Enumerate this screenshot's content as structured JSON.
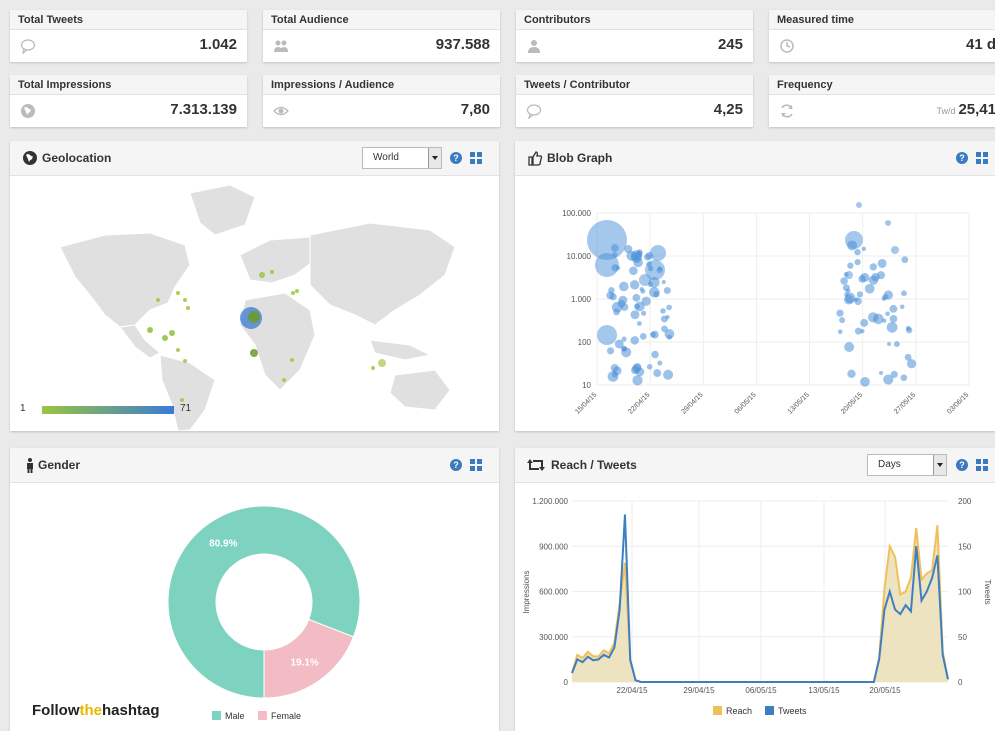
{
  "stats": [
    {
      "label": "Total Tweets",
      "value": "1.042",
      "icon": "speech-bubble-icon",
      "unit": ""
    },
    {
      "label": "Total Audience",
      "value": "937.588",
      "icon": "users-icon",
      "unit": ""
    },
    {
      "label": "Contributors",
      "value": "245",
      "icon": "user-icon",
      "unit": ""
    },
    {
      "label": "Measured time",
      "value": "41 d",
      "icon": "clock-icon",
      "unit": ""
    },
    {
      "label": "Total Impressions",
      "value": "7.313.139",
      "icon": "globe-icon",
      "unit": ""
    },
    {
      "label": "Impressions / Audience",
      "value": "7,80",
      "icon": "eye-icon",
      "unit": ""
    },
    {
      "label": "Tweets / Contributor",
      "value": "4,25",
      "icon": "speech-bubble-icon",
      "unit": ""
    },
    {
      "label": "Frequency",
      "value": "25,41",
      "icon": "refresh-icon",
      "unit": "Tw/d"
    }
  ],
  "geolocation": {
    "title": "Geolocation",
    "select": "World",
    "legend_min": "1",
    "legend_max": "71",
    "colors": {
      "low": "#9bc53d",
      "high": "#3a7bd5"
    }
  },
  "blob": {
    "title": "Blob Graph",
    "chart_data": {
      "type": "scatter",
      "y_scale": "log",
      "ylim": [
        10,
        100000
      ],
      "y_ticks": [
        "100.000",
        "10.000",
        "1.000",
        "100",
        "10"
      ],
      "x_ticks": [
        "15/04/15",
        "22/04/15",
        "29/04/15",
        "06/05/15",
        "13/05/15",
        "20/05/15",
        "27/05/15",
        "03/06/15"
      ],
      "note_colors": "#4a90d9"
    }
  },
  "gender": {
    "title": "Gender",
    "chart_data": {
      "type": "pie",
      "slices": [
        {
          "name": "Male",
          "value": 80.9,
          "label": "80.9%",
          "color": "#7dd3c0"
        },
        {
          "name": "Female",
          "value": 19.1,
          "label": "19.1%",
          "color": "#f3bcc4"
        }
      ]
    },
    "brand_prefix": "Follow",
    "brand_mid": "the",
    "brand_suffix": "hashtag"
  },
  "reach": {
    "title": "Reach / Tweets",
    "select": "Days",
    "chart_data": {
      "type": "area",
      "x_ticks": [
        "22/04/15",
        "29/04/15",
        "06/05/15",
        "13/05/15",
        "20/05/15"
      ],
      "y_left_ticks": [
        "1.200.000",
        "900.000",
        "600.000",
        "300.000",
        "0"
      ],
      "y_right_ticks": [
        "200",
        "150",
        "100",
        "50",
        "0"
      ],
      "ylabel": "Impressions",
      "y2label": "Tweets",
      "ylim": [
        0,
        1200000
      ],
      "y2lim": [
        0,
        200
      ],
      "series": [
        {
          "name": "Reach",
          "color": "#f0c05a",
          "values": [
            60000,
            180000,
            160000,
            200000,
            170000,
            170000,
            210000,
            190000,
            260000,
            520000,
            790000,
            150000,
            10000,
            0,
            0,
            0,
            0,
            0,
            0,
            0,
            0,
            0,
            0,
            0,
            0,
            0,
            0,
            0,
            0,
            0,
            0,
            0,
            0,
            0,
            0,
            0,
            0,
            0,
            0,
            0,
            0,
            0,
            0,
            0,
            0,
            0,
            0,
            0,
            0,
            0,
            0,
            0,
            0,
            0,
            0,
            0,
            0,
            0,
            160000,
            620000,
            900000,
            830000,
            580000,
            600000,
            690000,
            1020000,
            680000,
            720000,
            740000,
            1040000,
            200000,
            20000
          ]
        },
        {
          "name": "Tweets",
          "color": "#3d7fc1",
          "values": [
            10,
            25,
            22,
            28,
            24,
            25,
            30,
            27,
            38,
            80,
            185,
            24,
            2,
            0,
            0,
            0,
            0,
            0,
            0,
            0,
            0,
            0,
            0,
            0,
            0,
            0,
            0,
            0,
            0,
            0,
            0,
            0,
            0,
            0,
            0,
            0,
            0,
            0,
            0,
            0,
            0,
            0,
            0,
            0,
            0,
            0,
            0,
            0,
            0,
            0,
            0,
            0,
            0,
            0,
            0,
            0,
            0,
            0,
            25,
            80,
            100,
            80,
            75,
            85,
            78,
            150,
            90,
            100,
            115,
            140,
            30,
            3
          ]
        }
      ]
    }
  }
}
